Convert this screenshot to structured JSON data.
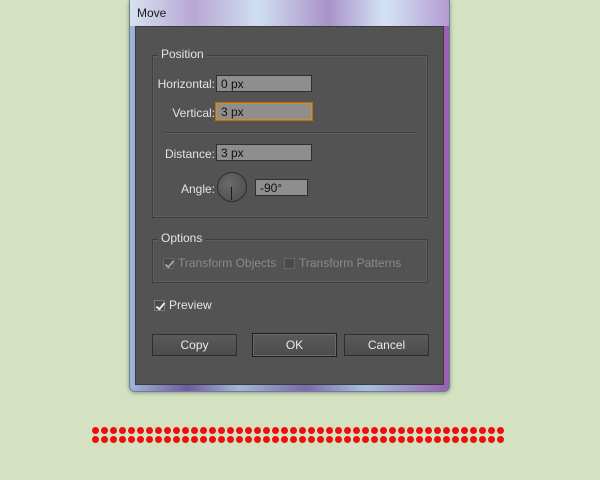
{
  "window": {
    "title": "Move"
  },
  "position_group": {
    "label": "Position",
    "horizontal_label": "Horizontal:",
    "horizontal_value": "0 px",
    "vertical_label": "Vertical:",
    "vertical_value": "3 px",
    "distance_label": "Distance:",
    "distance_value": "3 px",
    "angle_label": "Angle:",
    "angle_value": "-90°"
  },
  "options_group": {
    "label": "Options",
    "transform_objects": {
      "label": "Transform Objects",
      "checked": true,
      "enabled": false
    },
    "transform_patterns": {
      "label": "Transform Patterns",
      "checked": false,
      "enabled": false
    }
  },
  "preview": {
    "label": "Preview",
    "checked": true
  },
  "buttons": {
    "copy": "Copy",
    "ok": "OK",
    "cancel": "Cancel"
  },
  "colors": {
    "dialog_bg": "#535353",
    "page_bg": "#d4e2c2",
    "dots": "#f20d0d",
    "focus": "#d48a2c"
  }
}
